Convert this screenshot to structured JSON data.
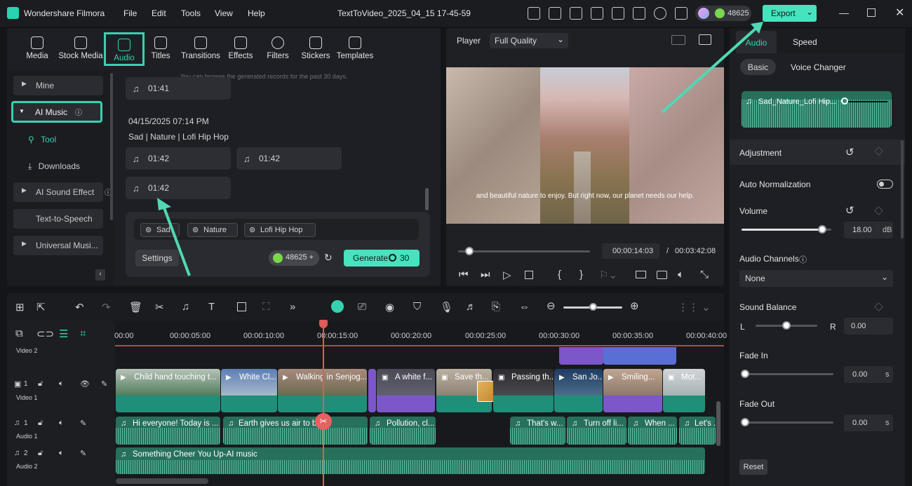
{
  "app": {
    "name": "Wondershare Filmora",
    "project": "TextToVideo_2025_04_15 17-45-59",
    "credits": "48625",
    "export_label": "Export"
  },
  "menu": [
    "File",
    "Edit",
    "Tools",
    "View",
    "Help"
  ],
  "media_tabs": [
    "Media",
    "Stock Media",
    "Audio",
    "Titles",
    "Transitions",
    "Effects",
    "Filters",
    "Stickers",
    "Templates"
  ],
  "sidebar": {
    "items": [
      "Mine",
      "AI Music",
      "Tool",
      "Downloads",
      "AI Sound Effect",
      "Text-to-Speech",
      "Universal Musi..."
    ]
  },
  "library": {
    "hint": "You can browse the generated records for the past 30 days.",
    "top_clip": "01:41",
    "date": "04/15/2025 07:14 PM",
    "tags_title": "Sad | Nature | Lofi Hip Hop",
    "clips": [
      "01:42",
      "01:42",
      "01:42"
    ],
    "tag_chips": [
      "Sad",
      "Nature",
      "Lofi Hip Hop"
    ],
    "settings_label": "Settings",
    "credit_value": "48625",
    "generate_label": "Generate",
    "generate_cost": "30"
  },
  "player": {
    "label": "Player",
    "quality": "Full Quality",
    "subtitle": "and beautiful nature to enjoy. But right now, our planet needs our help.",
    "current_time": "00:00:14:03",
    "separator": "/",
    "total_time": "00:03:42:08"
  },
  "right_panel": {
    "tabs": [
      "Audio",
      "Speed"
    ],
    "subtabs": [
      "Basic",
      "Voice Changer"
    ],
    "clip_name": "Sad_Nature_Lofi Hip...",
    "adjustment": "Adjustment",
    "auto_normalization": "Auto Normalization",
    "volume_label": "Volume",
    "volume_value": "18.00",
    "volume_unit": "dB",
    "volume_level": 0.9,
    "audio_channels": "Audio Channels",
    "channel_value": "None",
    "sound_balance": "Sound Balance",
    "balance_left": "L",
    "balance_right": "R",
    "balance_value": "0.00",
    "fade_in": "Fade In",
    "fade_in_value": "0.00",
    "fade_out": "Fade Out",
    "fade_out_value": "0.00",
    "seconds_unit": "s",
    "reset_label": "Reset"
  },
  "timeline": {
    "ruler": [
      "00:00",
      "00:00:05:00",
      "00:00:10:00",
      "00:00:15:00",
      "00:00:20:00",
      "00:00:25:00",
      "00:00:30:00",
      "00:00:35:00",
      "00:00:40:00"
    ],
    "tracks": [
      "Video 2",
      "Video 1",
      "Audio 1",
      "Audio 2"
    ],
    "track_numbers": [
      "1",
      "1",
      "2"
    ],
    "video_clips": [
      "Child hand touching t...",
      "White Cl...",
      "Walking in Senjog...",
      "A white f...",
      "Save th...",
      "Passing th...",
      "San Jo...",
      "Smiling...",
      "Mot..."
    ],
    "audio1_clips": [
      "Hi everyone! Today is ...",
      "Earth gives us air to br...",
      "Pollution, cl...",
      "That's w...",
      "Turn off li...",
      "When ...",
      "Let's ..."
    ],
    "audio2_clip": "Something Cheer You Up-AI music"
  },
  "colors": {
    "accent": "#36d1b0",
    "panel": "#232429",
    "video_clip": "#1f8f7a",
    "purple": "#7b57c9",
    "blue": "#5a6fd6",
    "audio_clip": "#27705c"
  }
}
